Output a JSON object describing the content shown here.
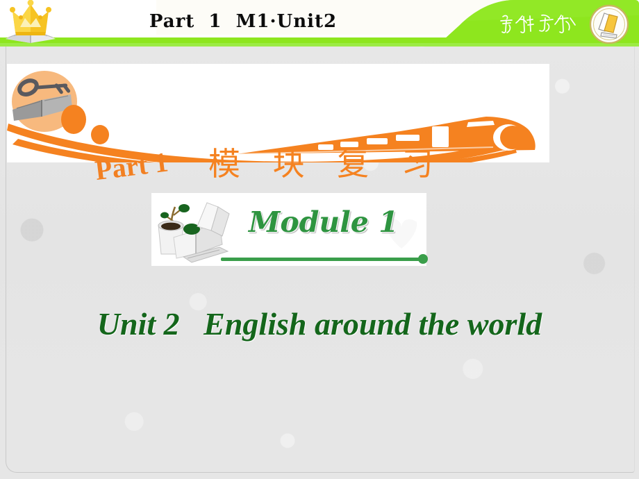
{
  "slide": {
    "background_color": "#e6e6e6",
    "accent_green": "#8ee61e",
    "accent_orange": "#f58220",
    "title_green": "#14661b",
    "module_green": "#2e9440"
  },
  "header": {
    "title": "Part  1  M1·Unit2",
    "brand_text": "学海导航",
    "crown_icon_name": "crown-on-book-icon",
    "logo_icon_name": "stacked-books-logo-icon",
    "bar_color": "#8ee61e"
  },
  "banner": {
    "part_label": "Part 1",
    "chinese_label": "模 块 复 习",
    "key_icon_name": "key-on-open-book-icon",
    "train_icon_name": "bullet-train-icon",
    "accent_color": "#f58220"
  },
  "module": {
    "title": "Module 1",
    "icon_name": "potted-plant-and-books-icon",
    "rule_color": "#3a9e4a"
  },
  "unit": {
    "title": "Unit 2   English around the world"
  }
}
